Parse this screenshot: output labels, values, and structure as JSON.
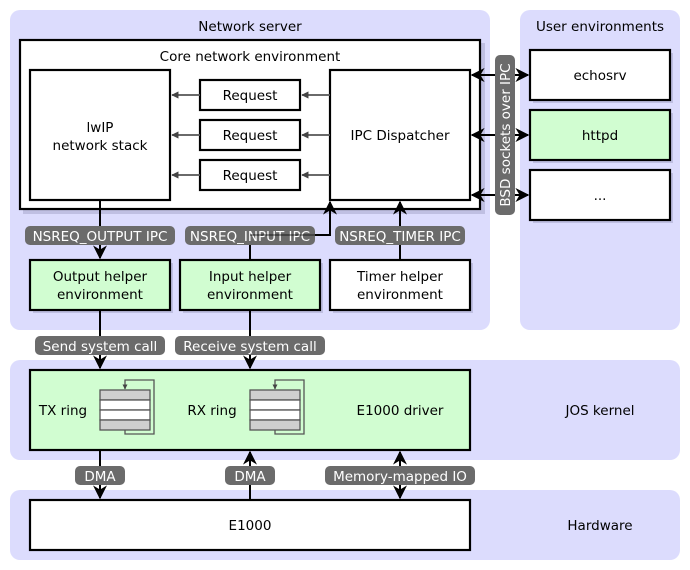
{
  "panels": {
    "network_server": "Network server",
    "user_environments": "User environments",
    "jos_kernel": "JOS kernel",
    "hardware": "Hardware"
  },
  "core": {
    "title": "Core network environment",
    "lwip": [
      "lwIP",
      "network stack"
    ],
    "requests": [
      "Request",
      "Request",
      "Request"
    ],
    "dispatcher": "IPC Dispatcher"
  },
  "user_envs": [
    "echosrv",
    "httpd",
    "..."
  ],
  "bsd_label": "BSD sockets over IPC",
  "helpers": {
    "output": [
      "Output helper",
      "environment"
    ],
    "input": [
      "Input helper",
      "environment"
    ],
    "timer": [
      "Timer helper",
      "environment"
    ]
  },
  "ipc_labels": {
    "output": "NSREQ_OUTPUT IPC",
    "input": "NSREQ_INPUT IPC",
    "timer": "NSREQ_TIMER IPC"
  },
  "syscall_labels": {
    "send": "Send system call",
    "receive": "Receive system call"
  },
  "kernel": {
    "tx_ring": "TX ring",
    "rx_ring": "RX ring",
    "driver": "E1000 driver"
  },
  "hw_labels": {
    "dma_tx": "DMA",
    "dma_rx": "DMA",
    "mmio": "Memory-mapped IO"
  },
  "hardware": {
    "e1000": "E1000"
  },
  "colors": {
    "panel": "#dcdcfd",
    "highlight_box": "#d1fdd1",
    "label_pill": "#6b6b6b"
  }
}
